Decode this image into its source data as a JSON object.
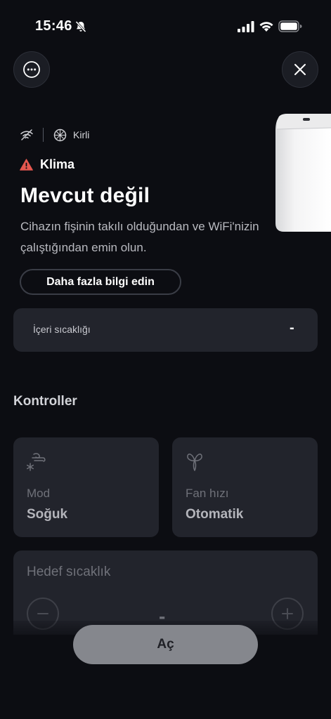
{
  "status_bar": {
    "time": "15:46"
  },
  "device": {
    "filter_status": "Kirli",
    "name": "Klima",
    "title": "Mevcut değil",
    "description": "Cihazın fişinin takılı olduğundan ve WiFi'nizin çalıştığından emin olun.",
    "info_button": "Daha fazla bilgi edin"
  },
  "indoor": {
    "label": "İçeri sıcaklığı",
    "value": "-"
  },
  "controls": {
    "section_title": "Kontroller",
    "mode": {
      "label": "Mod",
      "value": "Soğuk"
    },
    "fan": {
      "label": "Fan hızı",
      "value": "Otomatik"
    },
    "target": {
      "label": "Hedef sıcaklık",
      "value": "-"
    }
  },
  "power_button": "Aç",
  "colors": {
    "background": "#0c0d12",
    "card": "#22242c",
    "warning": "#e5574f",
    "button": "#85878d"
  },
  "icons": [
    "bell-slash-icon",
    "signal-icon",
    "wifi-icon",
    "battery-icon",
    "more-icon",
    "close-icon",
    "wifi-off-icon",
    "filter-icon",
    "warning-icon",
    "snow-wind-icon",
    "fan-icon",
    "minus-icon",
    "plus-icon"
  ]
}
